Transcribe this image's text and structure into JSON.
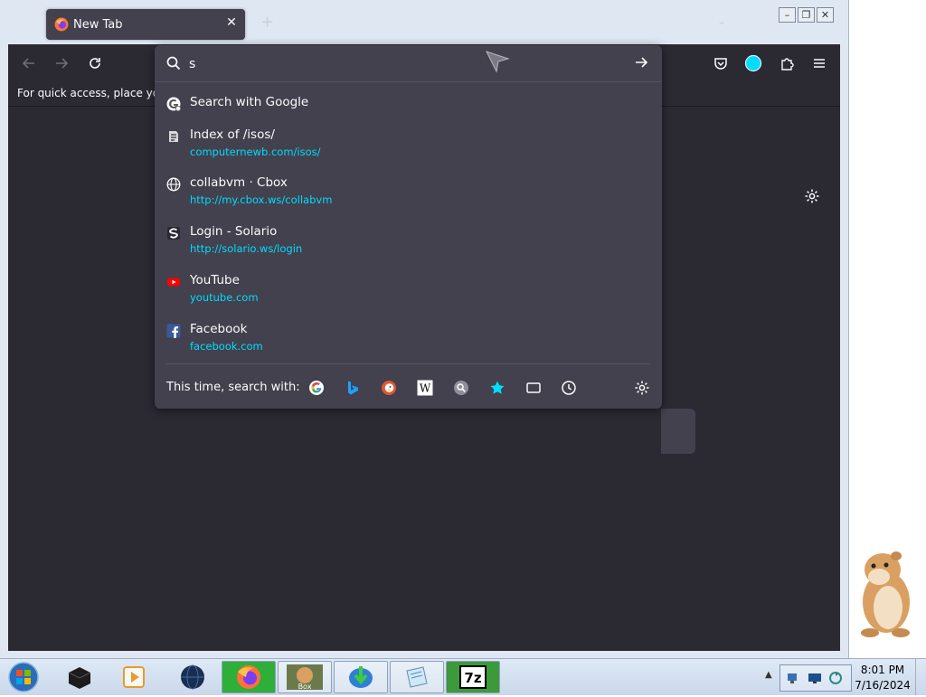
{
  "browser": {
    "tab_title": "New Tab",
    "tab_close_glyph": "✕",
    "new_tab_glyph": "+",
    "tab_list_glyph": "⌄",
    "bookmarks_hint": "For quick access, place your b",
    "window_controls": {
      "minimize": "–",
      "maximize": "❐",
      "close": "✕"
    }
  },
  "urlbar": {
    "value": "s",
    "results": [
      {
        "title": "Search with Google",
        "url": "",
        "icon": "google-search-icon"
      },
      {
        "title": "Index of /isos/",
        "url": "computernewb.com/isos/",
        "icon": "site-icon"
      },
      {
        "title": "collabvm · Cbox",
        "url": "http://my.cbox.ws/collabvm",
        "icon": "globe-icon"
      },
      {
        "title": "Login - Solario",
        "url": "http://solario.ws/login",
        "icon": "solario-icon"
      },
      {
        "title": "YouTube",
        "url": "youtube.com",
        "icon": "youtube-icon"
      },
      {
        "title": "Facebook",
        "url": "facebook.com",
        "icon": "facebook-icon"
      }
    ],
    "oneoff_label": "This time, search with:",
    "engines": [
      "google",
      "bing",
      "duckduckgo",
      "wikipedia",
      "search",
      "bookmarks",
      "tabs",
      "history"
    ]
  },
  "taskbar": {
    "apps": [
      "virtualbox",
      "media-player",
      "globe",
      "firefox",
      "ubuntu-box",
      "internet-download-manager",
      "notepad",
      "7zip"
    ],
    "clock_time": "8:01 PM",
    "clock_date": "7/16/2024"
  },
  "colors": {
    "panel_bg": "#42414d",
    "page_bg": "#2b2a33",
    "link": "#00ddff",
    "accent": "#00ddff"
  }
}
